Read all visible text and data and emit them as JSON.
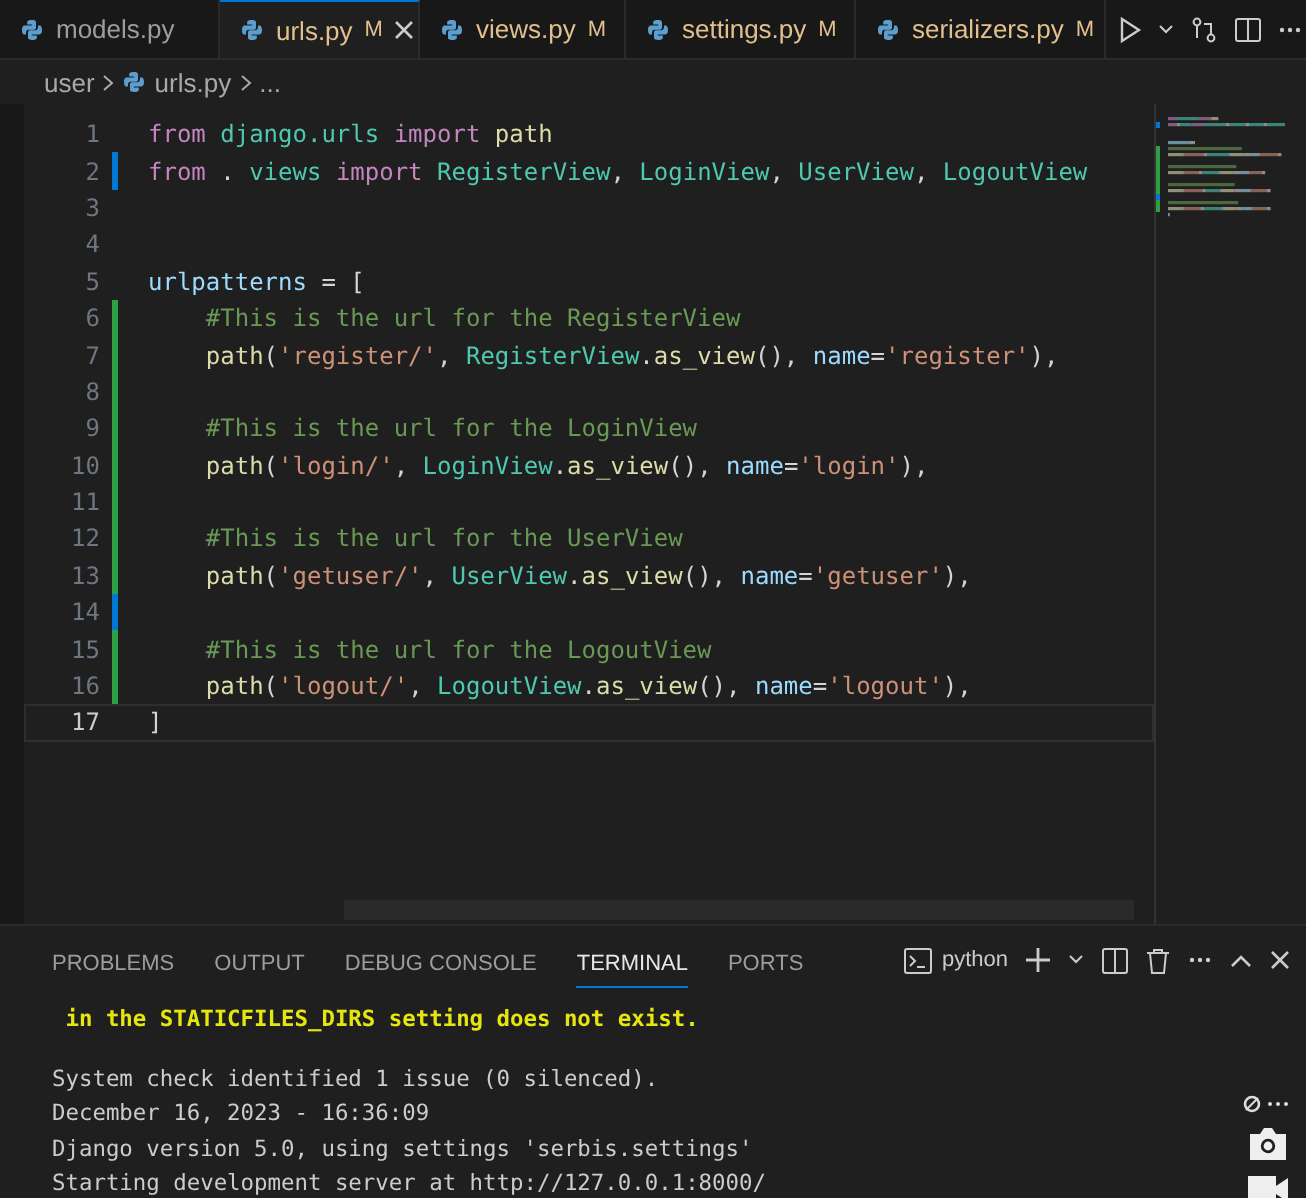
{
  "tabs": [
    {
      "label": "models.py",
      "selected": false
    },
    {
      "label": "urls.py",
      "badge": "M",
      "selected": true
    },
    {
      "label": "views.py",
      "badge": "M",
      "selected": false
    },
    {
      "label": "settings.py",
      "badge": "M",
      "selected": false
    },
    {
      "label": "serializers.py",
      "badge": "M",
      "selected": false
    }
  ],
  "breadcrumb": [
    "user",
    "urls.py",
    "..."
  ],
  "code": [
    {
      "n": "1",
      "tokens": [
        {
          "kind": "keyword",
          "text": "from "
        },
        {
          "kind": "module",
          "text": "django.urls "
        },
        {
          "kind": "keyword",
          "text": "import "
        },
        {
          "kind": "function",
          "text": "path"
        }
      ]
    },
    {
      "n": "2",
      "kind": "modified",
      "tokens": [
        {
          "kind": "keyword",
          "text": "from "
        },
        {
          "kind": "plain",
          "text": ". "
        },
        {
          "kind": "module",
          "text": "views "
        },
        {
          "kind": "keyword",
          "text": "import "
        },
        {
          "kind": "class",
          "text": "RegisterView"
        },
        {
          "kind": "plain",
          "text": ", "
        },
        {
          "kind": "class",
          "text": "LoginView"
        },
        {
          "kind": "plain",
          "text": ", "
        },
        {
          "kind": "class",
          "text": "UserView"
        },
        {
          "kind": "plain",
          "text": ", "
        },
        {
          "kind": "class",
          "text": "LogoutView"
        }
      ]
    },
    {
      "n": "3"
    },
    {
      "n": "4"
    },
    {
      "n": "5",
      "tokens": [
        {
          "kind": "variable",
          "text": "urlpatterns"
        },
        {
          "kind": "plain",
          "text": " = ["
        }
      ]
    },
    {
      "n": "6",
      "kind": "added",
      "tokens": [
        {
          "kind": "comment",
          "text": "    #This is the url for the RegisterView"
        }
      ]
    },
    {
      "n": "7",
      "kind": "added",
      "tokens": [
        {
          "kind": "function",
          "text": "    path"
        },
        {
          "kind": "plain",
          "text": "("
        },
        {
          "kind": "string",
          "text": "'register/'"
        },
        {
          "kind": "plain",
          "text": ", "
        },
        {
          "kind": "class",
          "text": "RegisterView"
        },
        {
          "kind": "plain",
          "text": "."
        },
        {
          "kind": "function",
          "text": "as_view"
        },
        {
          "kind": "plain",
          "text": "(), "
        },
        {
          "kind": "variable",
          "text": "name"
        },
        {
          "kind": "plain",
          "text": "="
        },
        {
          "kind": "string",
          "text": "'register'"
        },
        {
          "kind": "plain",
          "text": "),"
        }
      ]
    },
    {
      "n": "8",
      "kind": "added"
    },
    {
      "n": "9",
      "kind": "added",
      "tokens": [
        {
          "kind": "comment",
          "text": "    #This is the url for the LoginView"
        }
      ]
    },
    {
      "n": "10",
      "kind": "added",
      "tokens": [
        {
          "kind": "function",
          "text": "    path"
        },
        {
          "kind": "plain",
          "text": "("
        },
        {
          "kind": "string",
          "text": "'login/'"
        },
        {
          "kind": "plain",
          "text": ", "
        },
        {
          "kind": "class",
          "text": "LoginView"
        },
        {
          "kind": "plain",
          "text": "."
        },
        {
          "kind": "function",
          "text": "as_view"
        },
        {
          "kind": "plain",
          "text": "(), "
        },
        {
          "kind": "variable",
          "text": "name"
        },
        {
          "kind": "plain",
          "text": "="
        },
        {
          "kind": "string",
          "text": "'login'"
        },
        {
          "kind": "plain",
          "text": "),"
        }
      ]
    },
    {
      "n": "11",
      "kind": "added"
    },
    {
      "n": "12",
      "kind": "added",
      "tokens": [
        {
          "kind": "comment",
          "text": "    #This is the url for the UserView"
        }
      ]
    },
    {
      "n": "13",
      "kind": "added",
      "tokens": [
        {
          "kind": "function",
          "text": "    path"
        },
        {
          "kind": "plain",
          "text": "("
        },
        {
          "kind": "string",
          "text": "'getuser/'"
        },
        {
          "kind": "plain",
          "text": ", "
        },
        {
          "kind": "class",
          "text": "UserView"
        },
        {
          "kind": "plain",
          "text": "."
        },
        {
          "kind": "function",
          "text": "as_view"
        },
        {
          "kind": "plain",
          "text": "(), "
        },
        {
          "kind": "variable",
          "text": "name"
        },
        {
          "kind": "plain",
          "text": "="
        },
        {
          "kind": "string",
          "text": "'getuser'"
        },
        {
          "kind": "plain",
          "text": "),"
        }
      ]
    },
    {
      "n": "14",
      "kind": "modified"
    },
    {
      "n": "15",
      "kind": "added",
      "tokens": [
        {
          "kind": "comment",
          "text": "    #This is the url for the LogoutView"
        }
      ]
    },
    {
      "n": "16",
      "kind": "added",
      "tokens": [
        {
          "kind": "function",
          "text": "    path"
        },
        {
          "kind": "plain",
          "text": "("
        },
        {
          "kind": "string",
          "text": "'logout/'"
        },
        {
          "kind": "plain",
          "text": ", "
        },
        {
          "kind": "class",
          "text": "LogoutView"
        },
        {
          "kind": "plain",
          "text": "."
        },
        {
          "kind": "function",
          "text": "as_view"
        },
        {
          "kind": "plain",
          "text": "(), "
        },
        {
          "kind": "variable",
          "text": "name"
        },
        {
          "kind": "plain",
          "text": "="
        },
        {
          "kind": "string",
          "text": "'logout'"
        },
        {
          "kind": "plain",
          "text": "),"
        }
      ]
    },
    {
      "n": "17",
      "current": true,
      "tokens": [
        {
          "kind": "plain",
          "text": "]"
        }
      ]
    }
  ],
  "panel_tabs": [
    {
      "label": "PROBLEMS",
      "selected": false
    },
    {
      "label": "OUTPUT",
      "selected": false
    },
    {
      "label": "DEBUG CONSOLE",
      "selected": false
    },
    {
      "label": "TERMINAL",
      "selected": true
    },
    {
      "label": "PORTS",
      "selected": false
    }
  ],
  "terminal_name": "python",
  "terminal": [
    {
      "kind": "warning",
      "text": " in the STATICFILES_DIRS setting does not exist."
    },
    {
      "kind": "blank"
    },
    {
      "kind": "normal",
      "text": "System check identified 1 issue (0 silenced)."
    },
    {
      "kind": "normal",
      "text": "December 16, 2023 - 16:36:09"
    },
    {
      "kind": "normal",
      "text": "Django version 5.0, using settings 'serbis.settings'"
    },
    {
      "kind": "normal",
      "text": "Starting development server at http://127.0.0.1:8000/"
    }
  ]
}
